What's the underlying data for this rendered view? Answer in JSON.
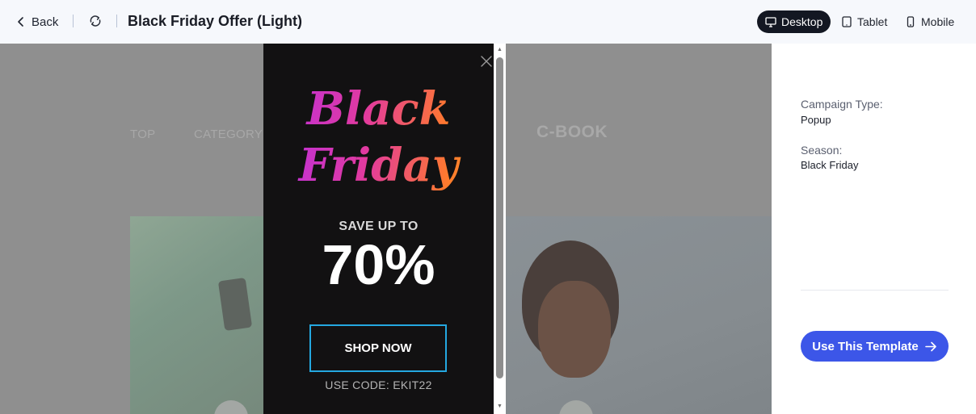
{
  "header": {
    "back_label": "Back",
    "title": "Black Friday Offer (Light)",
    "devices": [
      {
        "label": "Desktop",
        "icon": "monitor-icon",
        "active": true
      },
      {
        "label": "Tablet",
        "icon": "tablet-icon",
        "active": false
      },
      {
        "label": "Mobile",
        "icon": "mobile-icon",
        "active": false
      }
    ]
  },
  "site_preview": {
    "nav_items": [
      "TOP",
      "CATEGORY"
    ],
    "logo": "C-BOOK"
  },
  "popup": {
    "headline_line1": "Black",
    "headline_line2": "Friday",
    "save_text": "SAVE UP TO",
    "discount": "70%",
    "cta_label": "SHOP NOW",
    "code_text": "USE CODE: EKIT22",
    "cta_border_color": "#24a8e0",
    "gradient_colors": [
      "#b52ee8",
      "#e23a9e",
      "#ff7a2c",
      "#ffa62b"
    ]
  },
  "sidebar": {
    "campaign_type_label": "Campaign Type:",
    "campaign_type_value": "Popup",
    "season_label": "Season:",
    "season_value": "Black Friday",
    "use_template_label": "Use This Template",
    "accent_color": "#3c56e8"
  }
}
